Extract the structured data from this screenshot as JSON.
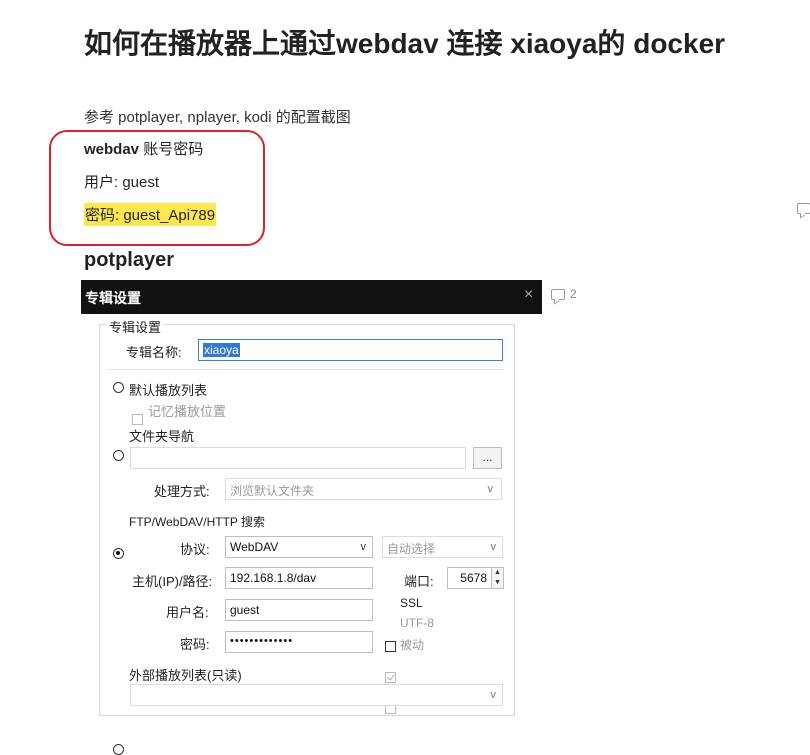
{
  "article": {
    "title": "如何在播放器上通过webdav 连接 xiaoya的 docker",
    "intro": "参考 potplayer, nplayer, kodi 的配置截图",
    "cred_heading_bold": "webdav",
    "cred_heading_rest": " 账号密码",
    "user_line": "用户: guest",
    "pass_line": "密码: guest_Api789",
    "section_heading": "potplayer",
    "comment_count": "2"
  },
  "dialog": {
    "title": "专辑设置",
    "close": "×",
    "group_label": "专辑设置",
    "album_name_label": "专辑名称:",
    "album_name_value": "xiaoya",
    "radio_default_playlist": "默认播放列表",
    "check_remember_position": "记忆播放位置",
    "radio_folder_nav": "文件夹导航",
    "folder_path_value": "",
    "browse_button": "...",
    "process_label": "处理方式:",
    "process_value": "浏览默认文件夹",
    "radio_ftp": "FTP/WebDAV/HTTP 搜索",
    "protocol_label": "协议:",
    "protocol_value": "WebDAV",
    "encoding_value": "自动选择",
    "host_label": "主机(IP)/路径:",
    "host_value": "192.168.1.8/dav",
    "port_label": "端口:",
    "port_value": "5678",
    "username_label": "用户名:",
    "username_value": "guest",
    "password_label": "密码:",
    "password_value": "•••••••••••••",
    "ssl_label": "SSL",
    "utf8_label": "UTF-8",
    "passive_label": "被动",
    "radio_external_playlist": "外部播放列表(只读)",
    "external_value": "",
    "caret": "v",
    "spin_up": "▲",
    "spin_down": "▼"
  },
  "colors": {
    "highlight": "#fde74c",
    "annotation_red": "#d8232a",
    "selection_blue": "#3478d6"
  }
}
